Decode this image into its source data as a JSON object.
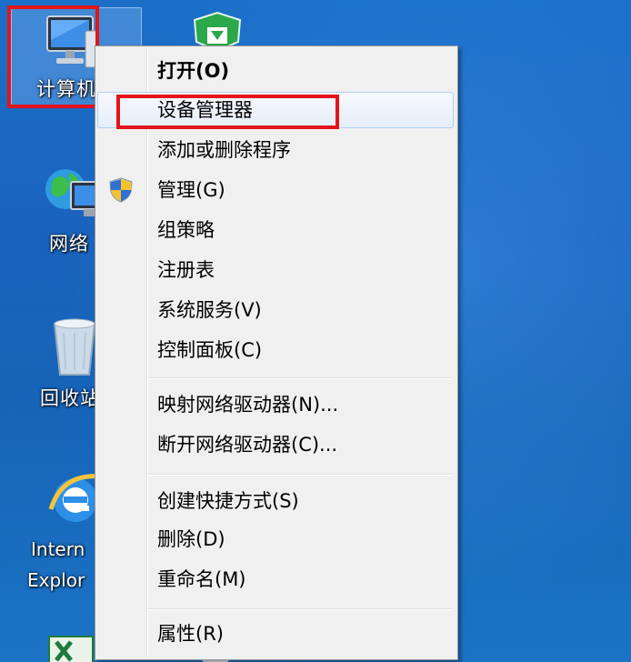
{
  "desktop": {
    "icons": [
      {
        "label": "计算机",
        "icon": "computer-icon"
      },
      {
        "label": "网络",
        "icon": "network-icon"
      },
      {
        "label": "回收站",
        "icon": "recycle-bin-icon"
      },
      {
        "label": "Internet Explorer",
        "label_line1": "Intern",
        "label_line2": "Explor",
        "icon": "internet-explorer-icon"
      },
      {
        "label": "",
        "icon": "shield-security-icon"
      },
      {
        "label": "",
        "icon": "excel-icon"
      }
    ]
  },
  "context_menu": {
    "items": [
      {
        "label": "打开(O)",
        "bold": true
      },
      {
        "label": "设备管理器",
        "highlighted": true
      },
      {
        "label": "添加或删除程序"
      },
      {
        "label": "管理(G)",
        "icon": "uac-shield-icon"
      },
      {
        "label": "组策略"
      },
      {
        "label": "注册表"
      },
      {
        "label": "系统服务(V)"
      },
      {
        "label": "控制面板(C)"
      },
      {
        "label": "映射网络驱动器(N)..."
      },
      {
        "label": "断开网络驱动器(C)..."
      },
      {
        "label": "创建快捷方式(S)"
      },
      {
        "label": "删除(D)"
      },
      {
        "label": "重命名(M)"
      },
      {
        "label": "属性(R)"
      }
    ]
  },
  "colors": {
    "desktop_blue": "#1a63bd",
    "annotation_red": "#e3141b",
    "menu_background": "#f0f0f0",
    "hover_border": "#aecff7"
  }
}
